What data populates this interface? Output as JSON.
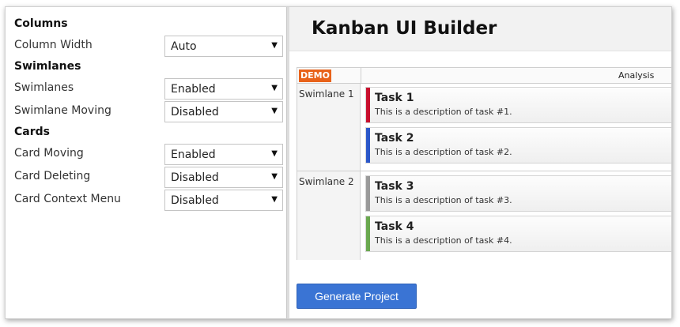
{
  "settings": {
    "columns": {
      "title": "Columns",
      "rows": [
        {
          "label": "Column Width",
          "value": "Auto"
        }
      ]
    },
    "swimlanes": {
      "title": "Swimlanes",
      "rows": [
        {
          "label": "Swimlanes",
          "value": "Enabled"
        },
        {
          "label": "Swimlane Moving",
          "value": "Disabled"
        }
      ]
    },
    "cards": {
      "title": "Cards",
      "rows": [
        {
          "label": "Card Moving",
          "value": "Enabled"
        },
        {
          "label": "Card Deleting",
          "value": "Disabled"
        },
        {
          "label": "Card Context Menu",
          "value": "Disabled"
        }
      ]
    },
    "dropdown_caret": "▼"
  },
  "preview": {
    "title": "Kanban UI Builder",
    "demo_badge": "DEMO",
    "column_title": "Analysis",
    "swimlanes": [
      {
        "label": "Swimlane 1",
        "cards": [
          {
            "title": "Task 1",
            "description": "This is a description of task #1.",
            "color": "#c8102e"
          },
          {
            "title": "Task 2",
            "description": "This is a description of task #2.",
            "color": "#2b57c9"
          }
        ]
      },
      {
        "label": "Swimlane 2",
        "cards": [
          {
            "title": "Task 3",
            "description": "This is a description of task #3.",
            "color": "#9a9a9a"
          },
          {
            "title": "Task 4",
            "description": "This is a description of task #4.",
            "color": "#6aa84f"
          }
        ]
      }
    ],
    "generate_button": "Generate Project"
  },
  "colors": {
    "accent_button": "#3a74d4",
    "demo_badge": "#e8621a"
  }
}
